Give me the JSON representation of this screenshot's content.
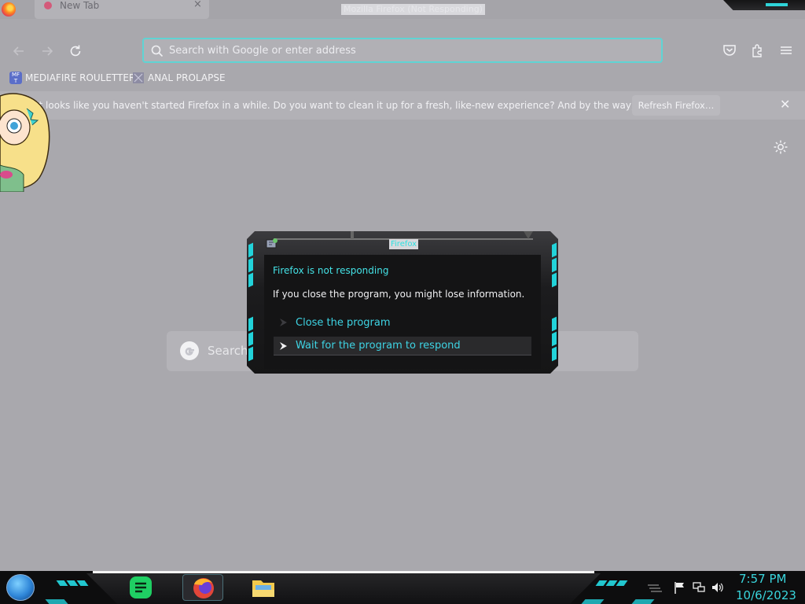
{
  "window": {
    "title": "Mozilla Firefox (Not Responding)",
    "tab_label": "New Tab",
    "tab_close": "×"
  },
  "navbar": {
    "back_icon": "arrow-left-icon",
    "forward_icon": "arrow-right-icon",
    "reload_icon": "reload-icon",
    "url_placeholder": "Search with Google or enter address",
    "toolbar_icons": [
      "pocket-icon",
      "extensions-icon",
      "menu-icon"
    ]
  },
  "bookmarks": [
    {
      "label": "MEDIAFIRE ROULETTER",
      "icon": "mediafire-icon"
    },
    {
      "label": "ANAL PROLAPSE",
      "icon": "bookmark-icon"
    }
  ],
  "notification": {
    "message": "It looks like you haven't started Firefox in a while. Do you want to clean it up for a fresh, like-new experience? And by the way, welcome back!",
    "button": "Refresh Firefox…",
    "close": "✕"
  },
  "page": {
    "search_placeholder": "Search"
  },
  "dialog": {
    "title": "Firefox",
    "heading": "Firefox is not responding",
    "info": "If you close the program, you might lose information.",
    "options": [
      {
        "label": "Close the program",
        "selected": false
      },
      {
        "label": "Wait for the program to respond",
        "selected": true
      }
    ]
  },
  "taskbar": {
    "apps": [
      "start-orb",
      "notes-app",
      "firefox-app",
      "file-explorer-app"
    ],
    "tray_icons": [
      "flag-icon",
      "network-icon",
      "volume-icon"
    ],
    "time": "7:57 PM",
    "date": "10/6/2023"
  },
  "colors": {
    "accent_teal": "#3ed4e4",
    "page_bg": "#a9a8ad",
    "dialog_bg": "#141415"
  }
}
